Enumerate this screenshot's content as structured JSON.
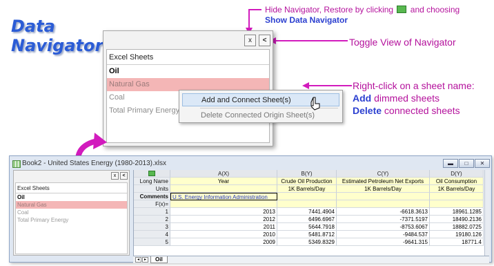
{
  "heading": [
    "Data",
    "Navigator"
  ],
  "callouts": {
    "hide_line1_prefix": "Hide Navigator, Restore by clicking",
    "hide_line1_suffix": "and choosing",
    "hide_line2": "Show Data Navigator",
    "toggle": "Toggle View of Navigator",
    "rightclick_line1": "Right-click on a sheet name:",
    "add_bold": "Add",
    "add_rest": " dimmed sheets",
    "delete_bold": "Delete",
    "delete_rest": " connected sheets"
  },
  "navigator": {
    "close_btn": "x",
    "collapse_btn": "<",
    "header": "Excel Sheets",
    "sheets": [
      "Oil",
      "Natural Gas",
      "Coal",
      "Total Primary Energy"
    ]
  },
  "context_menu": {
    "items": [
      "Add and Connect Sheet(s)",
      "Delete Connected Origin Sheet(s)"
    ]
  },
  "book": {
    "title": "Book2 - United States Energy (1980-2013).xlsx",
    "tab": "Oil",
    "columns": [
      {
        "name": "A(X)",
        "long": "Year",
        "units": "",
        "comments": "U.S. Energy Information Administration"
      },
      {
        "name": "B(Y)",
        "long": "Crude Oil Production",
        "units": "1K Barrels/Day",
        "comments": ""
      },
      {
        "name": "C(Y)",
        "long": "Estimated Petroleum Net Exports",
        "units": "1K Barrels/Day",
        "comments": ""
      },
      {
        "name": "D(Y)",
        "long": "Oil Consumption",
        "units": "1K Barrels/Day",
        "comments": ""
      }
    ],
    "row_labels": [
      "Long Name",
      "Units",
      "Comments",
      "F(x)="
    ],
    "rows": [
      [
        "1",
        "2013",
        "7441.4904",
        "-6618.3613",
        "18961.1285"
      ],
      [
        "2",
        "2012",
        "6496.6967",
        "-7371.5197",
        "18490.2136"
      ],
      [
        "3",
        "2011",
        "5644.7918",
        "-8753.6067",
        "18882.0725"
      ],
      [
        "4",
        "2010",
        "5481.8712",
        "-9484.537",
        "19180.126"
      ],
      [
        "5",
        "2009",
        "5349.8329",
        "-9641.315",
        "18771.4"
      ]
    ]
  },
  "colors": {
    "callout": "#b4119c",
    "heading": "#2b5cd6",
    "selected_sheet": "#f4b6b6"
  }
}
